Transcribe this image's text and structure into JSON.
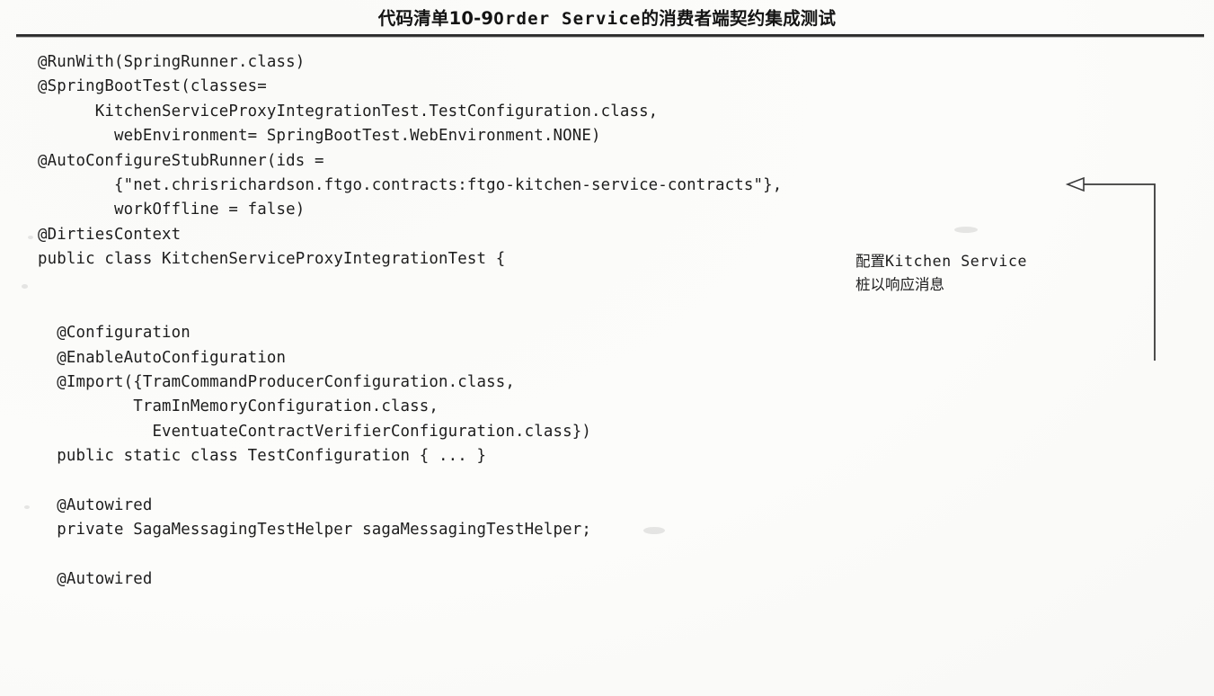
{
  "caption": {
    "prefix": "代码清单10-9",
    "mono": "Order Service",
    "suffix": "的消费者端契约集成测试",
    "full": "代码清单10-9  Order Service的消费者端契约集成测试"
  },
  "code": {
    "language": "java",
    "lines": [
      "@RunWith(SpringRunner.class)",
      "@SpringBootTest(classes=",
      "      KitchenServiceProxyIntegrationTest.TestConfiguration.class,",
      "        webEnvironment= SpringBootTest.WebEnvironment.NONE)",
      "@AutoConfigureStubRunner(ids =",
      "        {\"net.chrisrichardson.ftgo.contracts:ftgo-kitchen-service-contracts\"},",
      "        workOffline = false)",
      "@DirtiesContext",
      "public class KitchenServiceProxyIntegrationTest {",
      "",
      "",
      "  @Configuration",
      "  @EnableAutoConfiguration",
      "  @Import({TramCommandProducerConfiguration.class,",
      "          TramInMemoryConfiguration.class,",
      "            EventuateContractVerifierConfiguration.class})",
      "  public static class TestConfiguration { ... }",
      "",
      "  @Autowired",
      "  private SagaMessagingTestHelper sagaMessagingTestHelper;",
      "",
      "  @Autowired"
    ]
  },
  "annotations": [
    {
      "id": "kitchen-stub-callout",
      "line1_cn": "配置",
      "line1_mono": "Kitchen Service",
      "line2_cn": "桩以响应消息",
      "full_text": "配置 Kitchen Service 桩以响应消息",
      "arrow": "left-arrow-hollow",
      "target_line": "@AutoConfigureStubRunner(ids ="
    }
  ],
  "colors": {
    "page_background": "#fcfcfa",
    "text": "#1d1d1d",
    "rule": "#2b2b2b",
    "leader_line": "#3a3a3a"
  }
}
